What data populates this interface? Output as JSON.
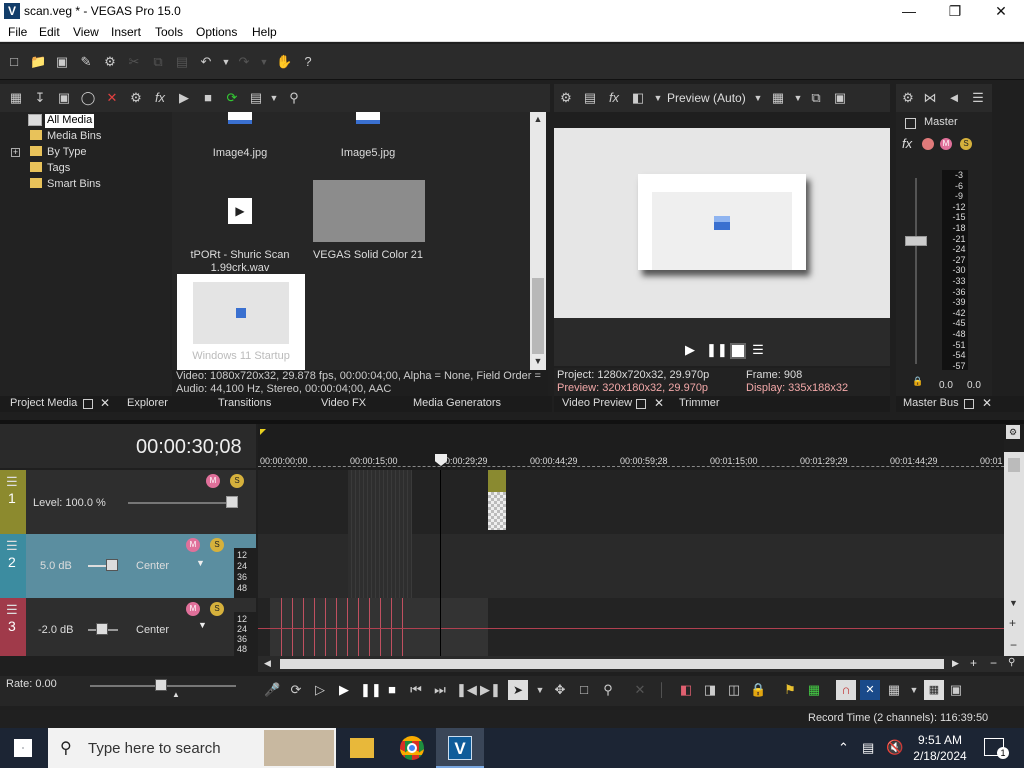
{
  "window": {
    "title": "scan.veg * - VEGAS Pro 15.0",
    "app_icon": "V"
  },
  "menu": [
    "File",
    "Edit",
    "View",
    "Insert",
    "Tools",
    "Options",
    "Help"
  ],
  "media_tree": [
    "All Media",
    "Media Bins",
    "By Type",
    "Tags",
    "Smart Bins"
  ],
  "media_items": [
    {
      "name": "Image4.jpg"
    },
    {
      "name": "Image5.jpg"
    },
    {
      "name": "tPORt - Shuric Scan 1.99crk.wav"
    },
    {
      "name": "VEGAS Solid Color 21"
    },
    {
      "name": "Windows 11 Startup"
    }
  ],
  "media_info": {
    "video": "Video: 1080x720x32, 29.878 fps, 00:00:04;00, Alpha = None, Field Order =",
    "audio": "Audio: 44,100 Hz, Stereo, 00:00:04;00, AAC"
  },
  "left_tabs": [
    "Project Media",
    "Explorer",
    "Transitions",
    "Video FX",
    "Media Generators"
  ],
  "preview": {
    "mode": "Preview (Auto)",
    "project": "Project:  1280x720x32, 29.970p",
    "preview": "Preview:  320x180x32, 29.970p",
    "frame": "Frame:   908",
    "display": "Display:  335x188x32"
  },
  "preview_tabs": [
    "Video Preview",
    "Trimmer"
  ],
  "master": {
    "label": "Master",
    "scale": [
      "-3",
      "-6",
      "-9",
      "-12",
      "-15",
      "-18",
      "-21",
      "-24",
      "-27",
      "-30",
      "-33",
      "-36",
      "-39",
      "-42",
      "-45",
      "-48",
      "-51",
      "-54",
      "-57"
    ],
    "left_val": "0.0",
    "right_val": "0.0",
    "tab": "Master Bus"
  },
  "timecode": "00:00:30;08",
  "ruler_labels": [
    "00:00:00;00",
    "00:00:15;00",
    "00:00:29;29",
    "00:00:44;29",
    "00:00:59;28",
    "00:01:15;00",
    "00:01:29;29",
    "00:01:44;29",
    "00:01"
  ],
  "tracks": [
    {
      "num": "1",
      "level": "Level: 100.0 %",
      "color": "#8c8a2e"
    },
    {
      "num": "2",
      "vol": "5.0 dB",
      "pan": "Center",
      "color": "#3c8ca0",
      "scale": [
        "12",
        "24",
        "36",
        "48"
      ]
    },
    {
      "num": "3",
      "vol": "-2.0 dB",
      "pan": "Center",
      "color": "#a03a4a",
      "scale": [
        "12",
        "24",
        "36",
        "48"
      ]
    }
  ],
  "rate": "Rate: 0.00",
  "status": "Record Time (2 channels): 116:39:50",
  "taskbar": {
    "search": "Type here to search",
    "time": "9:51 AM",
    "date": "2/18/2024",
    "notif": "1"
  }
}
